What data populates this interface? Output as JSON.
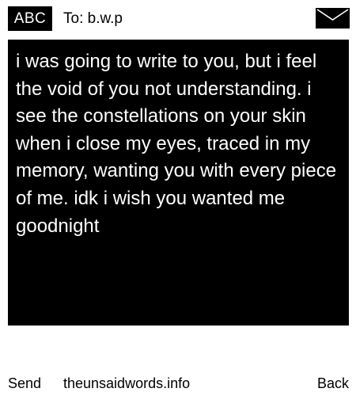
{
  "header": {
    "mode_label": "ABC",
    "recipient": "To: b.w.p",
    "icon": "envelope-icon"
  },
  "message": {
    "text": "i was going to write to you, but i feel the void of you not understanding. i see the constellations on your skin when i close my eyes, traced in my memory, wanting you with every piece of me. idk i wish you wanted me goodnight"
  },
  "footer": {
    "send_label": "Send",
    "site_label": "theunsaidwords.info",
    "back_label": "Back"
  },
  "colors": {
    "background": "#ffffff",
    "message_box": "#000000",
    "message_text": "#ffffff",
    "text": "#000000"
  }
}
